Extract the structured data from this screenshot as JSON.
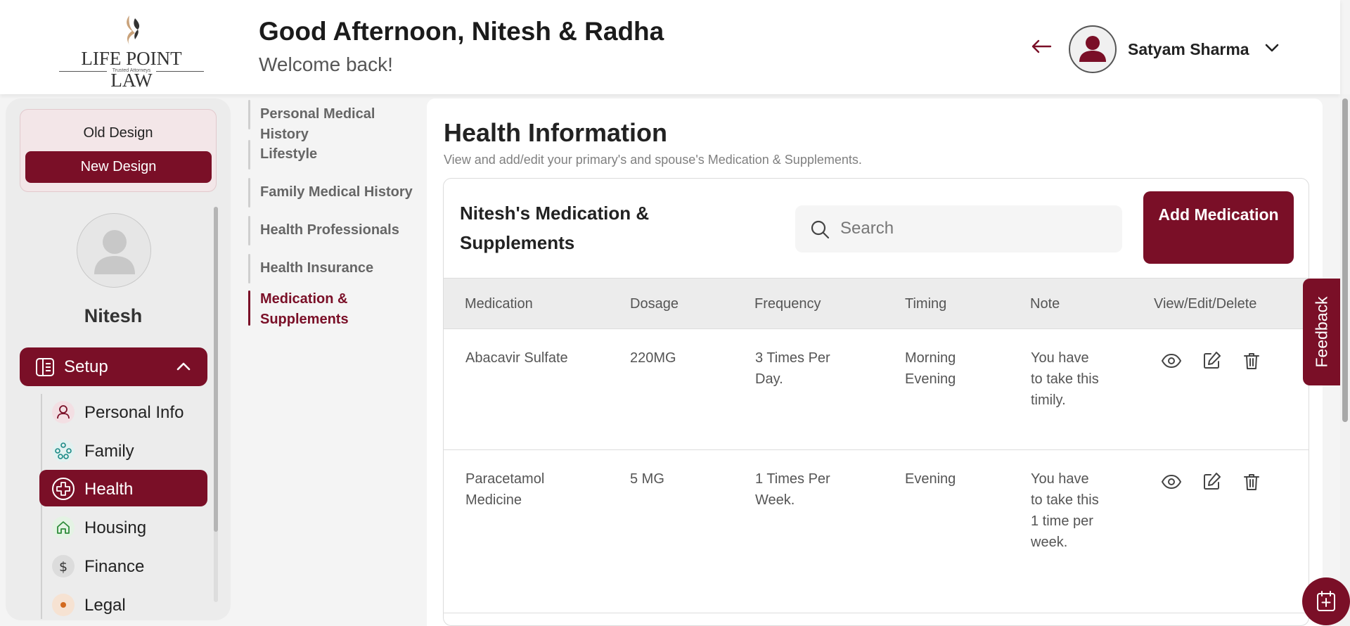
{
  "brand": {
    "name": "LIFE POINT LAW",
    "tagline": "Trusted Attorneys"
  },
  "header": {
    "greeting": "Good Afternoon, Nitesh & Radha",
    "welcome": "Welcome back!",
    "user_name": "Satyam Sharma",
    "icons": {
      "back": "arrow-left-icon",
      "avatar": "user-avatar-icon",
      "menu": "chevron-down-icon"
    }
  },
  "sidebar": {
    "old_design": "Old Design",
    "new_design": "New Design",
    "profile_name": "Nitesh",
    "setup_label": "Setup",
    "items": [
      {
        "label": "Personal Info",
        "icon": "person-icon"
      },
      {
        "label": "Family",
        "icon": "family-tree-icon"
      },
      {
        "label": "Health",
        "icon": "health-plus-icon",
        "active": true
      },
      {
        "label": "Housing",
        "icon": "home-icon"
      },
      {
        "label": "Finance",
        "icon": "dollar-icon"
      },
      {
        "label": "Legal",
        "icon": "legal-icon"
      }
    ]
  },
  "subnav": {
    "items": [
      {
        "label": "Personal Medical History"
      },
      {
        "label": "Lifestyle"
      },
      {
        "label": "Family Medical History"
      },
      {
        "label": "Health Professionals"
      },
      {
        "label": "Health Insurance"
      },
      {
        "label": "Medication & Supplements",
        "line1": "Medication &",
        "line2": "Supplements",
        "active": true
      }
    ]
  },
  "main": {
    "title": "Health Information",
    "subtitle": "View and add/edit your primary's and spouse's Medication & Supplements.",
    "card_title": "Nitesh's Medication & Supplements",
    "search_placeholder": "Search",
    "add_button": "Add Medication",
    "columns": [
      "Medication",
      "Dosage",
      "Frequency",
      "Timing",
      "Note",
      "View/Edit/Delete"
    ],
    "rows": [
      {
        "medication": "Abacavir Sulfate",
        "dosage": "220MG",
        "frequency": "3 Times Per Day.",
        "timing": "Morning Evening",
        "note": "You have to take this timily."
      },
      {
        "medication": "Paracetamol Medicine",
        "dosage": "5 MG",
        "frequency": "1 Times Per Week.",
        "timing": "Evening",
        "note": "You have to take this 1 time per week."
      }
    ]
  },
  "feedback_label": "Feedback",
  "colors": {
    "brand": "#7a0f27",
    "background": "#f4f4f4",
    "card": "#ffffff"
  }
}
